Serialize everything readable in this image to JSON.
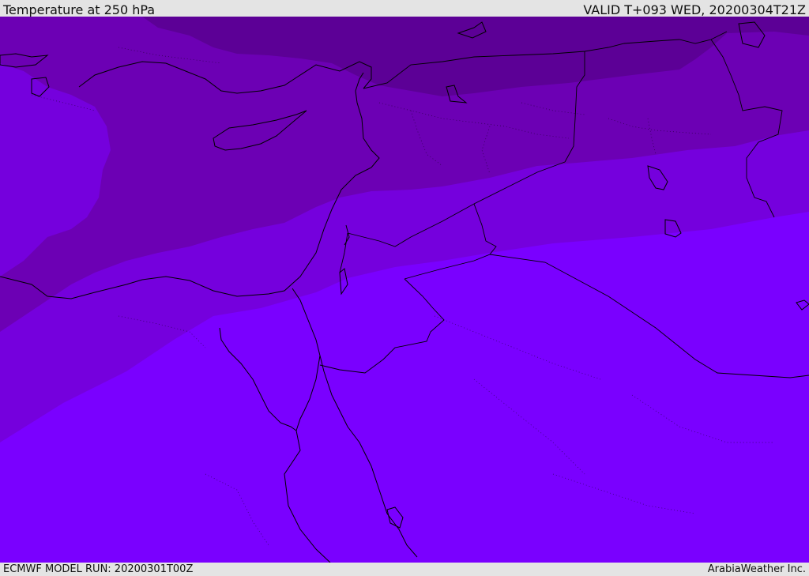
{
  "header": {
    "title": "Temperature at 250 hPa",
    "valid": "VALID T+093 WED, 20200304T21Z"
  },
  "footer": {
    "model_run": "ECMWF MODEL RUN: 20200301T00Z",
    "credit": "ArabiaWeather Inc."
  },
  "map": {
    "field": "temperature-250hpa",
    "colors": {
      "warmest": "#7a00ff",
      "warm": "#7500dd",
      "mid": "#6c00b4",
      "cool": "#5c0096",
      "coast": "#000000",
      "border": "#000000"
    }
  }
}
